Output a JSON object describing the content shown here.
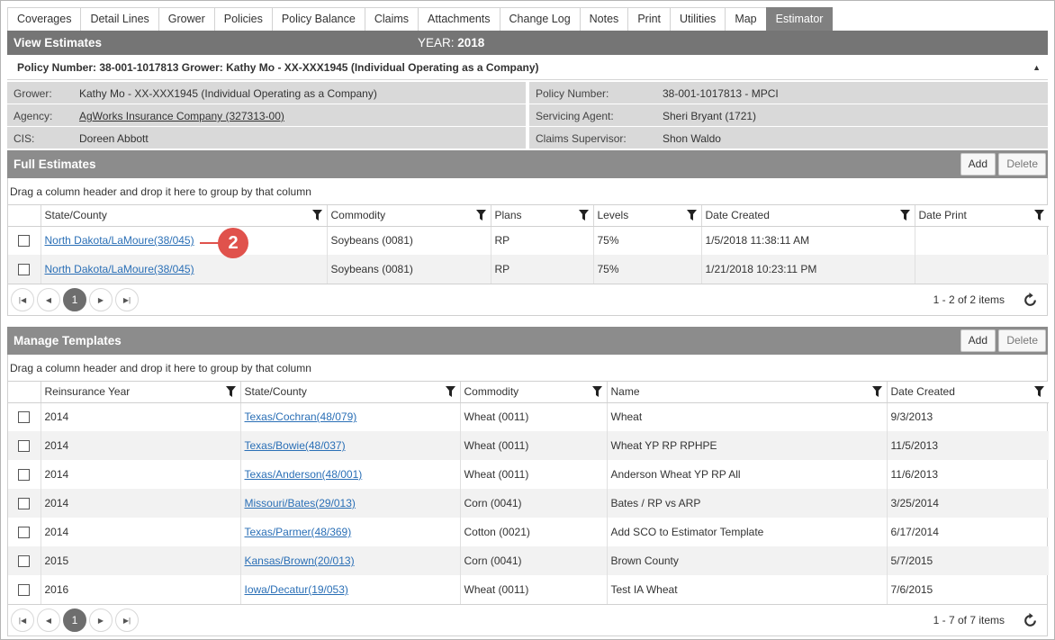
{
  "tabs": [
    "Coverages",
    "Detail Lines",
    "Grower",
    "Policies",
    "Policy Balance",
    "Claims",
    "Attachments",
    "Change Log",
    "Notes",
    "Print",
    "Utilities",
    "Map",
    "Estimator"
  ],
  "active_tab": "Estimator",
  "header": {
    "title": "View Estimates",
    "year_label": "YEAR:",
    "year_value": "2018"
  },
  "policy_bar": {
    "text": "Policy Number: 38-001-1017813 Grower: Kathy Mo - XX-XXX1945 (Individual Operating as a Company)"
  },
  "info": {
    "grower_label": "Grower:",
    "grower_value": "Kathy Mo - XX-XXX1945 (Individual Operating as a Company)",
    "agency_label": "Agency:",
    "agency_value": "AgWorks Insurance Company (327313-00)",
    "cis_label": "CIS:",
    "cis_value": "Doreen Abbott",
    "policy_label": "Policy Number:",
    "policy_value": "38-001-1017813 - MPCI",
    "agent_label": "Servicing Agent:",
    "agent_value": "Sheri Bryant (1721)",
    "supervisor_label": "Claims Supervisor:",
    "supervisor_value": "Shon Waldo"
  },
  "full_estimates": {
    "title": "Full Estimates",
    "add_label": "Add",
    "delete_label": "Delete",
    "group_hint": "Drag a column header and drop it here to group by that column",
    "columns": [
      "State/County",
      "Commodity",
      "Plans",
      "Levels",
      "Date Created",
      "Date Print"
    ],
    "rows": [
      [
        "North Dakota/LaMoure(38/045)",
        "Soybeans (0081)",
        "RP",
        "75%",
        "1/5/2018 11:38:11 AM",
        ""
      ],
      [
        "North Dakota/LaMoure(38/045)",
        "Soybeans (0081)",
        "RP",
        "75%",
        "1/21/2018 10:23:11 PM",
        ""
      ]
    ],
    "page": "1",
    "items_text": "1 - 2 of 2 items"
  },
  "callout": "2",
  "templates": {
    "title": "Manage Templates",
    "add_label": "Add",
    "delete_label": "Delete",
    "group_hint": "Drag a column header and drop it here to group by that column",
    "columns": [
      "Reinsurance Year",
      "State/County",
      "Commodity",
      "Name",
      "Date Created"
    ],
    "rows": [
      [
        "2014",
        "Texas/Cochran(48/079)",
        "Wheat (0011)",
        "Wheat",
        "9/3/2013"
      ],
      [
        "2014",
        "Texas/Bowie(48/037)",
        "Wheat (0011)",
        "Wheat YP RP RPHPE",
        "11/5/2013"
      ],
      [
        "2014",
        "Texas/Anderson(48/001)",
        "Wheat (0011)",
        "Anderson Wheat YP RP All",
        "11/6/2013"
      ],
      [
        "2014",
        "Missouri/Bates(29/013)",
        "Corn (0041)",
        "Bates / RP vs ARP",
        "3/25/2014"
      ],
      [
        "2014",
        "Texas/Parmer(48/369)",
        "Cotton (0021)",
        "Add SCO to Estimator Template",
        "6/17/2014"
      ],
      [
        "2015",
        "Kansas/Brown(20/013)",
        "Corn (0041)",
        "Brown County",
        "5/7/2015"
      ],
      [
        "2016",
        "Iowa/Decatur(19/053)",
        "Wheat (0011)",
        "Test IA Wheat",
        "7/6/2015"
      ]
    ],
    "page": "1",
    "items_text": "1 - 7 of 7 items"
  }
}
